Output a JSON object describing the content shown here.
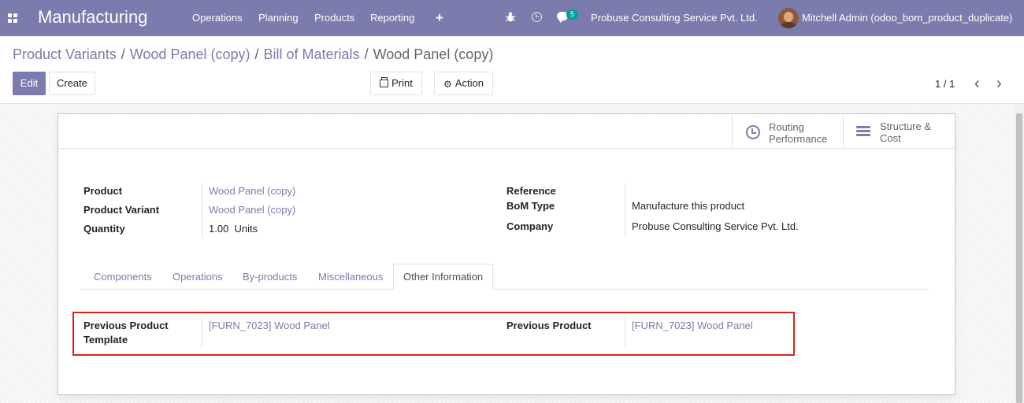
{
  "navbar": {
    "app_title": "Manufacturing",
    "menu": [
      "Operations",
      "Planning",
      "Products",
      "Reporting"
    ],
    "plus_icon": "+",
    "chat_count": "5",
    "company": "Probuse Consulting Service Pvt. Ltd.",
    "user": "Mitchell Admin (odoo_bom_product_duplicate)"
  },
  "breadcrumb": {
    "items": [
      "Product Variants",
      "Wood Panel (copy)",
      "Bill of Materials"
    ],
    "current": "Wood Panel (copy)",
    "separator": "/"
  },
  "toolbar": {
    "edit_label": "Edit",
    "create_label": "Create",
    "print_label": "Print",
    "action_label": "Action",
    "pager": "1 / 1",
    "prev_icon": "‹",
    "next_icon": "›"
  },
  "button_box": {
    "routing": [
      "Routing",
      "Performance"
    ],
    "structure": [
      "Structure &",
      "Cost"
    ]
  },
  "form": {
    "left": {
      "product_label": "Product",
      "product_value": "Wood Panel (copy)",
      "variant_label": "Product Variant",
      "variant_value": "Wood Panel (copy)",
      "quantity_label": "Quantity",
      "quantity_value": "1.00",
      "quantity_unit": "Units"
    },
    "right": {
      "reference_label": "Reference",
      "bom_type_label": "BoM Type",
      "bom_type_value": "Manufacture this product",
      "company_label": "Company",
      "company_value": "Probuse Consulting Service Pvt. Ltd."
    }
  },
  "tabs": [
    "Components",
    "Operations",
    "By-products",
    "Miscellaneous",
    "Other Information"
  ],
  "other_info": {
    "prev_template_label_line1": "Previous Product",
    "prev_template_label_line2": "Template",
    "prev_template_value": "[FURN_7023] Wood Panel",
    "prev_product_label": "Previous Product",
    "prev_product_value": "[FURN_7023] Wood Panel"
  },
  "colors": {
    "brand": "#7c7bad",
    "highlight": "#e0201b",
    "badge": "#00a09d"
  }
}
